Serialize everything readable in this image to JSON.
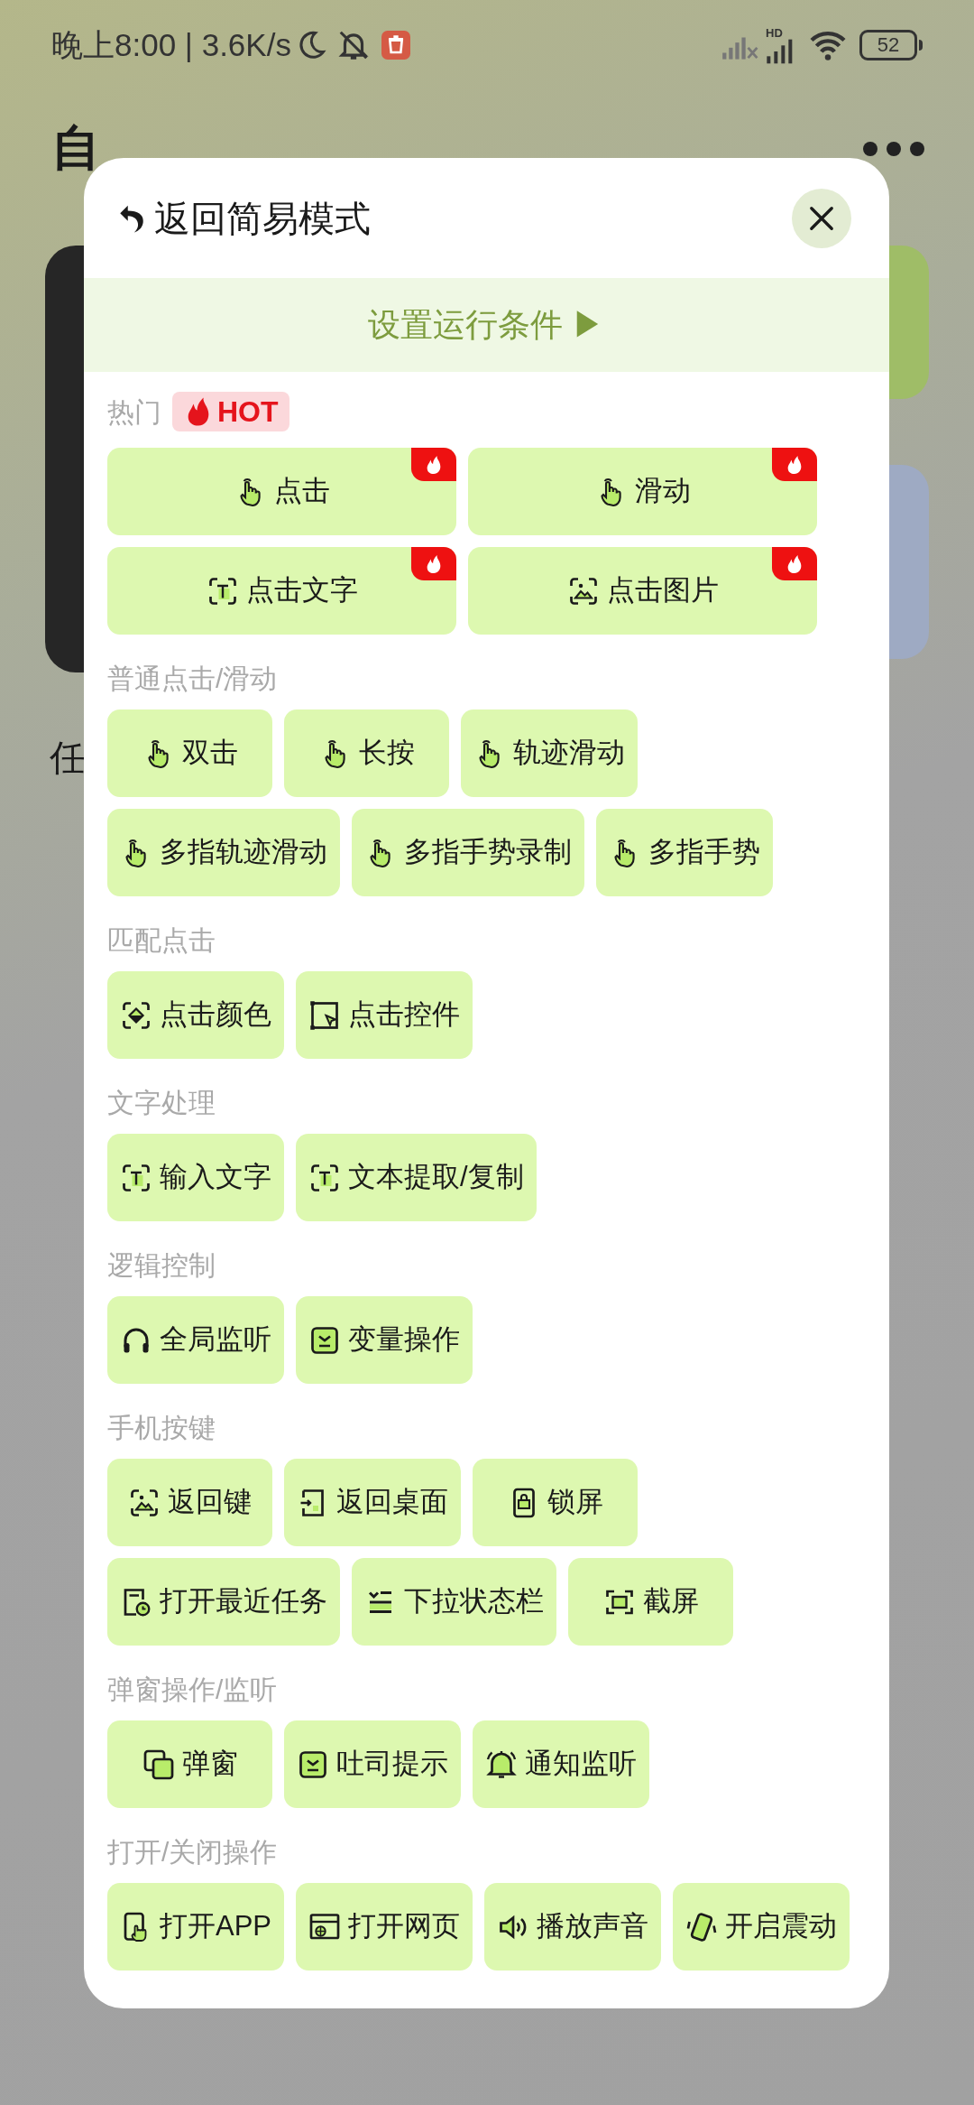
{
  "status_bar": {
    "time": "晚上8:00 | 3.6K/s",
    "network_label": "HD",
    "battery": "52"
  },
  "app": {
    "title": "自",
    "list_heading": "任"
  },
  "dialog": {
    "back_label": "返回简易模式",
    "condition_button": "设置运行条件 ▶",
    "sections": [
      {
        "title": "热门",
        "badge": "HOT",
        "kind": "grid",
        "items": [
          {
            "label": "点击",
            "hot": true
          },
          {
            "label": "滑动",
            "hot": true
          },
          {
            "label": "点击文字",
            "hot": true
          },
          {
            "label": "点击图片",
            "hot": true
          }
        ]
      },
      {
        "title": "普通点击/滑动",
        "kind": "flow",
        "items": [
          {
            "label": "双击"
          },
          {
            "label": "长按"
          },
          {
            "label": "轨迹滑动"
          },
          {
            "label": "多指轨迹滑动"
          },
          {
            "label": "多指手势录制"
          },
          {
            "label": "多指手势"
          }
        ]
      },
      {
        "title": "匹配点击",
        "kind": "flow",
        "items": [
          {
            "label": "点击颜色"
          },
          {
            "label": "点击控件"
          }
        ]
      },
      {
        "title": "文字处理",
        "kind": "flow",
        "items": [
          {
            "label": "输入文字"
          },
          {
            "label": "文本提取/复制"
          }
        ]
      },
      {
        "title": "逻辑控制",
        "kind": "flow",
        "items": [
          {
            "label": "全局监听"
          },
          {
            "label": "变量操作"
          }
        ]
      },
      {
        "title": "手机按键",
        "kind": "flow",
        "items": [
          {
            "label": "返回键"
          },
          {
            "label": "返回桌面"
          },
          {
            "label": "锁屏"
          },
          {
            "label": "打开最近任务"
          },
          {
            "label": "下拉状态栏"
          },
          {
            "label": "截屏"
          }
        ]
      },
      {
        "title": "弹窗操作/监听",
        "kind": "flow",
        "items": [
          {
            "label": "弹窗"
          },
          {
            "label": "吐司提示"
          },
          {
            "label": "通知监听"
          }
        ]
      },
      {
        "title": "打开/关闭操作",
        "kind": "flow",
        "items": [
          {
            "label": "打开APP"
          },
          {
            "label": "打开网页"
          },
          {
            "label": "播放声音"
          },
          {
            "label": "开启震动"
          }
        ]
      }
    ]
  }
}
